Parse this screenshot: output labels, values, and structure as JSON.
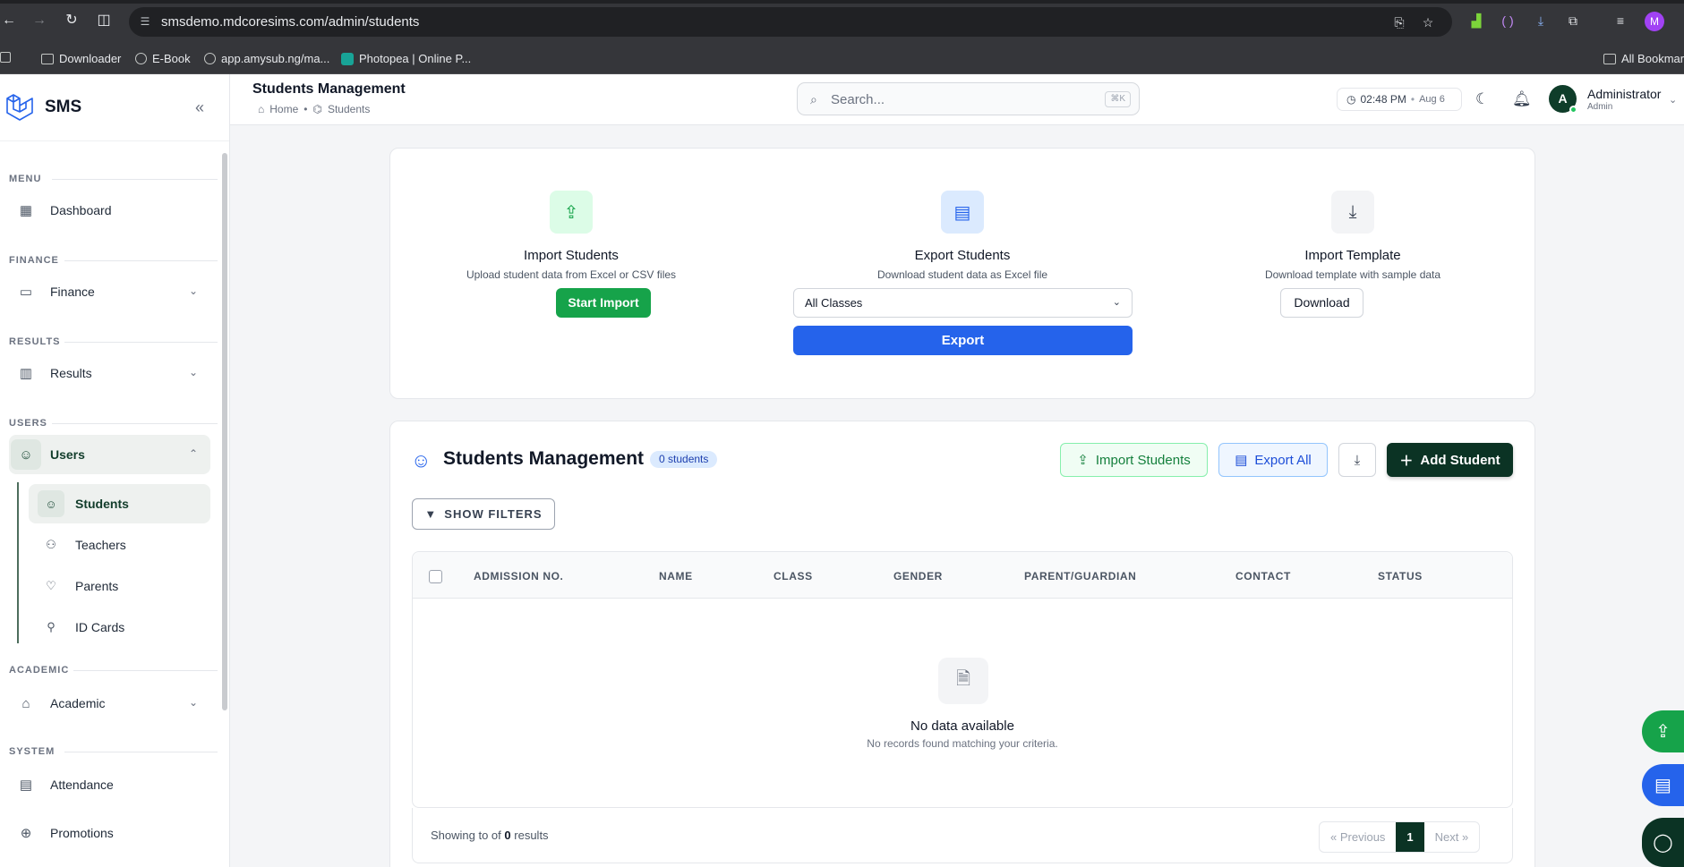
{
  "browser": {
    "url": "smsdemo.mdcoresims.com/admin/students",
    "bookmarks": [
      "Downloader",
      "E-Book",
      "app.amysub.ng/ma...",
      "Photopea | Online P..."
    ],
    "all_bookmarks": "All Bookmar",
    "profile_initial": "M"
  },
  "sidebar": {
    "brand": "SMS",
    "sections": {
      "menu": "MENU",
      "finance": "FINANCE",
      "results": "RESULTS",
      "users": "USERS",
      "academic": "ACADEMIC",
      "system": "SYSTEM"
    },
    "items": {
      "dashboard": "Dashboard",
      "finance": "Finance",
      "results": "Results",
      "users": "Users",
      "academic": "Academic",
      "attendance": "Attendance",
      "promotions": "Promotions"
    },
    "users_sub": {
      "students": "Students",
      "teachers": "Teachers",
      "parents": "Parents",
      "id_cards": "ID Cards"
    }
  },
  "header": {
    "title": "Students Management",
    "breadcrumb_home": "Home",
    "breadcrumb_current": "Students",
    "search_placeholder": "Search...",
    "search_shortcut": "⌘K",
    "time": "02:48 PM",
    "date": "Aug 6",
    "user_initial": "A",
    "user_name": "Administrator",
    "user_role": "Admin"
  },
  "tiles": {
    "import": {
      "title": "Import Students",
      "desc": "Upload student data from Excel or CSV files",
      "button": "Start Import"
    },
    "export": {
      "title": "Export Students",
      "desc": "Download student data as Excel file",
      "select_value": "All Classes",
      "button": "Export"
    },
    "template": {
      "title": "Import Template",
      "desc": "Download template with sample data",
      "button": "Download"
    }
  },
  "management": {
    "title": "Students Management",
    "count_badge": "0 students",
    "import_btn": "Import Students",
    "export_btn": "Export All",
    "add_btn": "Add Student",
    "filters_btn": "SHOW FILTERS",
    "columns": [
      "ADMISSION NO.",
      "NAME",
      "CLASS",
      "GENDER",
      "PARENT/GUARDIAN",
      "CONTACT",
      "STATUS"
    ],
    "empty_title": "No data available",
    "empty_desc": "No records found matching your criteria.",
    "showing_prefix": "Showing to of",
    "showing_count": "0",
    "showing_suffix": "results",
    "pager_prev": "« Previous",
    "pager_page": "1",
    "pager_next": "Next »"
  },
  "colors": {
    "brand_dark": "#0b3324",
    "accent_green": "#16a34a",
    "accent_blue": "#2563eb"
  }
}
